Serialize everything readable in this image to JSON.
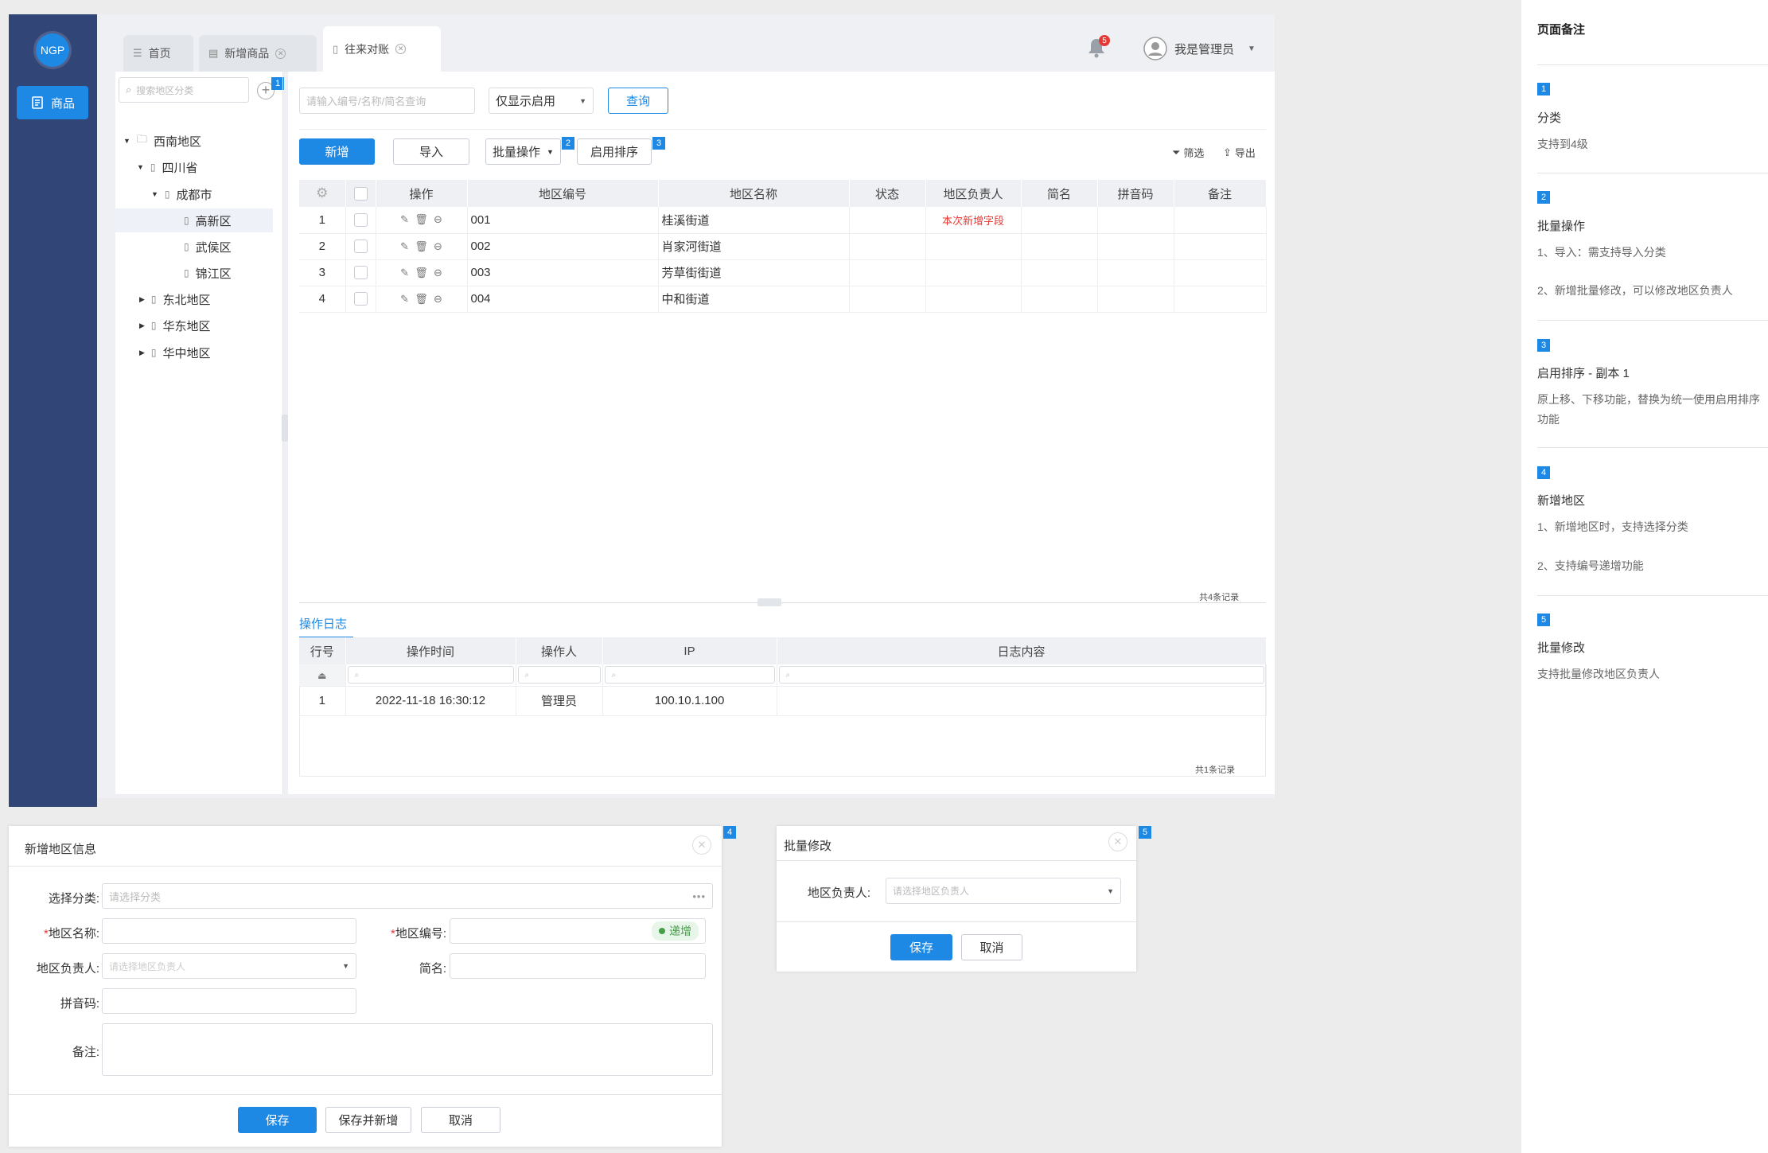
{
  "app": {
    "logo": "NGP",
    "nav_item": "商品"
  },
  "tabs": [
    {
      "label": "首页",
      "closable": false,
      "active": false
    },
    {
      "label": "新增商品",
      "closable": true,
      "active": false
    },
    {
      "label": "往来对账",
      "closable": true,
      "active": true
    }
  ],
  "header": {
    "notification_count": "5",
    "user_name": "我是管理员"
  },
  "tree": {
    "search_placeholder": "搜索地区分类",
    "badge": "1",
    "items": [
      {
        "label": "西南地区",
        "level": 0,
        "expanded": true,
        "selected": false
      },
      {
        "label": "四川省",
        "level": 1,
        "expanded": true,
        "selected": false
      },
      {
        "label": "成都市",
        "level": 2,
        "expanded": true,
        "selected": false
      },
      {
        "label": "高新区",
        "level": 3,
        "selected": true
      },
      {
        "label": "武侯区",
        "level": 3,
        "selected": false
      },
      {
        "label": "锦江区",
        "level": 3,
        "selected": false
      },
      {
        "label": "东北地区",
        "level": 1,
        "expanded": false,
        "selected": false
      },
      {
        "label": "华东地区",
        "level": 1,
        "expanded": false,
        "selected": false
      },
      {
        "label": "华中地区",
        "level": 1,
        "expanded": false,
        "selected": false
      }
    ]
  },
  "filter": {
    "search_placeholder": "请输入编号/名称/简名查询",
    "status_select": "仅显示启用",
    "query_button": "查询"
  },
  "toolbar": {
    "add": "新增",
    "import": "导入",
    "batch": "批量操作",
    "batch_badge": "2",
    "sort": "启用排序",
    "sort_badge": "3",
    "filter": "筛选",
    "export": "导出"
  },
  "grid": {
    "columns": [
      "操作",
      "地区编号",
      "地区名称",
      "状态",
      "地区负责人",
      "简名",
      "拼音码",
      "备注"
    ],
    "rows": [
      {
        "no": "1",
        "code": "001",
        "name": "桂溪街道",
        "manager": "本次新增字段"
      },
      {
        "no": "2",
        "code": "002",
        "name": "肖家河街道",
        "manager": ""
      },
      {
        "no": "3",
        "code": "003",
        "name": "芳草街街道",
        "manager": ""
      },
      {
        "no": "4",
        "code": "004",
        "name": "中和街道",
        "manager": ""
      }
    ],
    "total": "共4条记录"
  },
  "log": {
    "tab": "操作日志",
    "columns": [
      "行号",
      "操作时间",
      "操作人",
      "IP",
      "日志内容"
    ],
    "rows": [
      {
        "no": "1",
        "time": "2022-11-18 16:30:12",
        "operator": "管理员",
        "ip": "100.10.1.100",
        "content": ""
      }
    ],
    "total": "共1条记录"
  },
  "dialog_add": {
    "title": "新增地区信息",
    "badge": "4",
    "category_label": "选择分类:",
    "category_placeholder": "请选择分类",
    "name_label": "地区名称:",
    "code_label": "地区编号:",
    "increment_tag": "递增",
    "manager_label": "地区负责人:",
    "manager_placeholder": "请选择地区负责人",
    "short_label": "简名:",
    "pinyin_label": "拼音码:",
    "remark_label": "备注:",
    "save": "保存",
    "save_new": "保存并新增",
    "cancel": "取消"
  },
  "dialog_batch": {
    "title": "批量修改",
    "badge": "5",
    "manager_label": "地区负责人:",
    "manager_placeholder": "请选择地区负责人",
    "save": "保存",
    "cancel": "取消"
  },
  "notes": {
    "title": "页面备注",
    "items": [
      {
        "num": "1",
        "title": "分类",
        "lines": [
          "支持到4级"
        ]
      },
      {
        "num": "2",
        "title": "批量操作",
        "lines": [
          "1、导入：需支持导入分类",
          "2、新增批量修改，可以修改地区负责人"
        ]
      },
      {
        "num": "3",
        "title": "启用排序 - 副本 1",
        "lines": [
          "原上移、下移功能，替换为统一使用启用排序功能"
        ]
      },
      {
        "num": "4",
        "title": "新增地区",
        "lines": [
          "1、新增地区时，支持选择分类",
          "2、支持编号递增功能"
        ]
      },
      {
        "num": "5",
        "title": "批量修改",
        "lines": [
          "支持批量修改地区负责人"
        ]
      }
    ]
  },
  "colors": {
    "primary": "#1e88e5",
    "sidebar": "#324577",
    "danger": "#e53935",
    "success": "#43a047"
  }
}
